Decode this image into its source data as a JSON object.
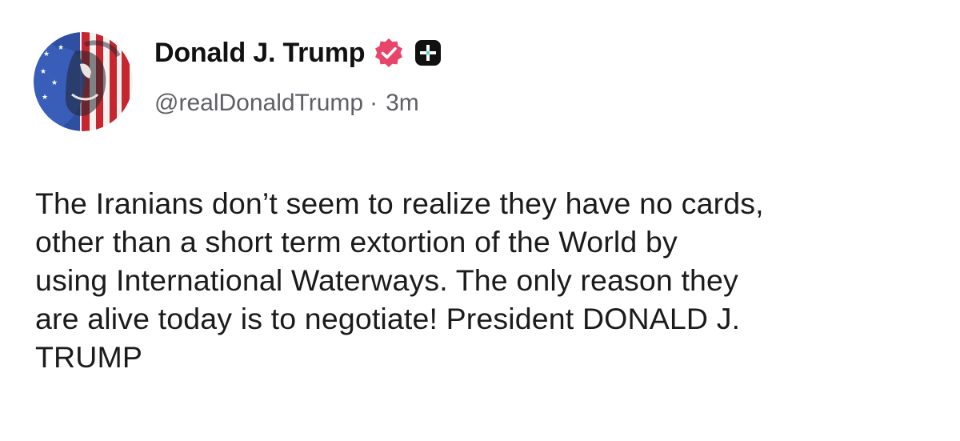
{
  "author": {
    "display_name": "Donald J. Trump",
    "handle": "@realDonaldTrump",
    "separator": "·",
    "time_ago": "3m",
    "verified_icon": "verified-badge-icon",
    "verified_color": "#e8456b",
    "plus_icon": "plus-badge-icon"
  },
  "post": {
    "lines": [
      "The Iranians don’t seem to realize they have no cards,",
      "other than a short term extortion of the World by",
      "using International Waterways. The only reason they",
      "are alive today is to negotiate! President DONALD J.",
      "TRUMP"
    ]
  }
}
